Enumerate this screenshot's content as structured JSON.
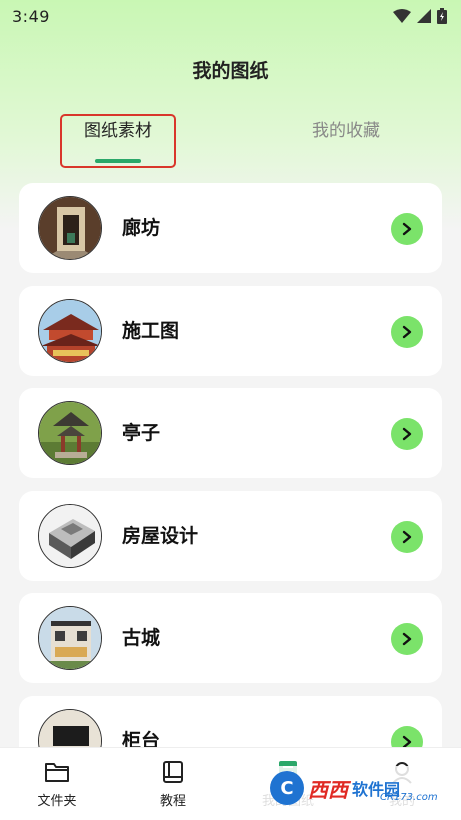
{
  "status": {
    "time": "3:49"
  },
  "header": {
    "title": "我的图纸"
  },
  "tabs": [
    {
      "label": "图纸素材",
      "active": true
    },
    {
      "label": "我的收藏",
      "active": false
    }
  ],
  "items": [
    {
      "label": "廊坊",
      "thumb": "corridor-photo"
    },
    {
      "label": "施工图",
      "thumb": "pagoda-roof-photo"
    },
    {
      "label": "亭子",
      "thumb": "pavilion-photo"
    },
    {
      "label": "房屋设计",
      "thumb": "floorplan-3d-photo"
    },
    {
      "label": "古城",
      "thumb": "villa-photo"
    },
    {
      "label": "柜台",
      "thumb": "tv-cabinet-photo"
    }
  ],
  "bottom_nav": [
    {
      "label": "文件夹",
      "icon": "folder-icon"
    },
    {
      "label": "教程",
      "icon": "book-icon"
    },
    {
      "label": "我的图纸",
      "icon": "drawing-icon"
    },
    {
      "label": "我的",
      "icon": "user-icon"
    }
  ],
  "watermark": {
    "brand": "西西",
    "sub": "软件园",
    "url": "CR173.com"
  },
  "colors": {
    "accent": "#2ba86a",
    "arrow_bg": "#7be36a",
    "highlight_border": "#d9362b"
  }
}
